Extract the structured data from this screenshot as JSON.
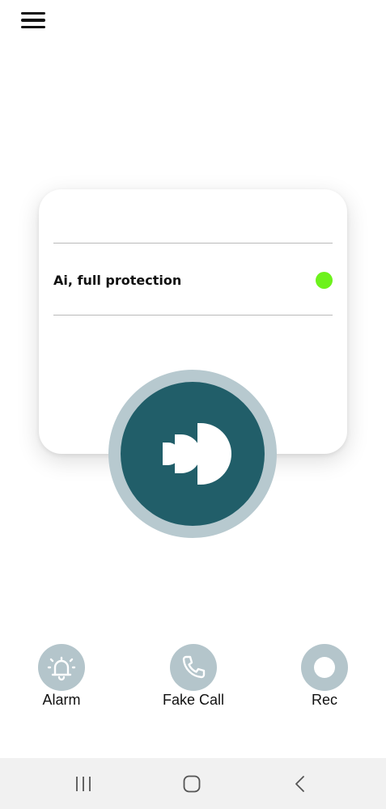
{
  "header": {
    "menu_icon": "hamburger-menu-icon"
  },
  "card": {
    "protection_label": "Ai, full protection",
    "status_color": "#6df21c",
    "status_active": true
  },
  "main_button": {
    "icon": "sound-waves-icon",
    "ring_color": "#b7c9cf",
    "fill_color": "#215e69"
  },
  "actions": [
    {
      "label": "Alarm",
      "icon": "bell-icon"
    },
    {
      "label": "Fake Call",
      "icon": "phone-icon"
    },
    {
      "label": "Rec",
      "icon": "record-icon"
    }
  ],
  "system_nav": {
    "recents_icon": "recents-icon",
    "home_icon": "home-icon",
    "back_icon": "back-icon"
  },
  "colors": {
    "accent": "#215e69",
    "action_bg": "#b4c5cb",
    "nav_bg": "#f1f1f1"
  }
}
